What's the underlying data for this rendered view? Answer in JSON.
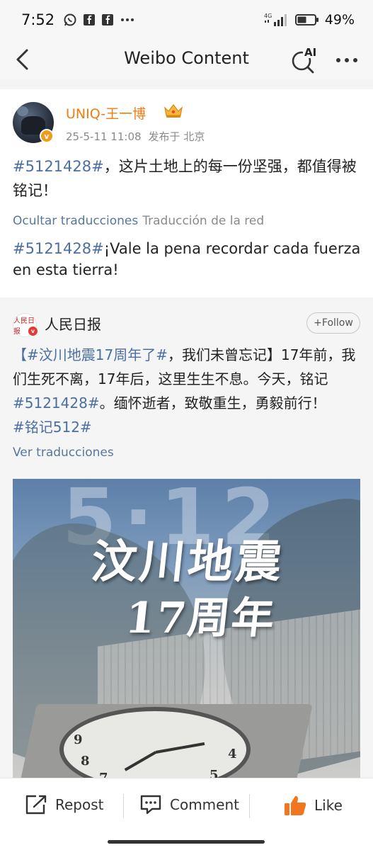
{
  "status_bar": {
    "time": "7:52",
    "battery_percent": "49%",
    "network": "4G",
    "icons_left": [
      "whatsapp-icon",
      "facebook-icon",
      "facebook-icon",
      "more-notifications-icon"
    ],
    "icons_right": [
      "signal-icon",
      "battery-icon"
    ]
  },
  "nav": {
    "title": "Weibo Content",
    "ai_label": "AI"
  },
  "post": {
    "username": "UNIQ-王一博",
    "date": "25-5-11 11:08",
    "location": "发布于 北京",
    "hashtag": "#5121428#",
    "text_rest": "，这片土地上的每一份坚强，都值得被铭记！",
    "hide_translation": "Ocultar traducciones",
    "translation_source": "Traducción de la red",
    "translated_hashtag": "#5121428#",
    "translated_rest": "¡Vale la pena recordar cada fuerza en esta tierra!",
    "verified_badge": "v"
  },
  "repost": {
    "name": "人民日报",
    "avatar_text": "人民日报",
    "follow_label": "+Follow",
    "seg1_hashtag": "【#汶川地震17周年了#",
    "seg1_rest": "，我们未曾忘记】17年前，我们生死不离，17年后，这里生生不息。今天，铭记",
    "seg2_hashtag": "#5121428#",
    "seg2_rest": "。缅怀逝者，致敬重生，勇毅前行！",
    "seg3_hashtag": "#铭记512#",
    "see_translations": "Ver traducciones",
    "image": {
      "big_text": "5·12",
      "title_line1": "汶川地震",
      "title_line2": "17周年",
      "clock_numbers": [
        "9",
        "8",
        "7",
        "4",
        "5"
      ]
    }
  },
  "actions": {
    "repost_label": "Repost",
    "comment_label": "Comment",
    "like_label": "Like"
  },
  "colors": {
    "accent_orange": "#f07c14",
    "link_blue": "#4a6fa5",
    "like_orange": "#f2761f"
  }
}
